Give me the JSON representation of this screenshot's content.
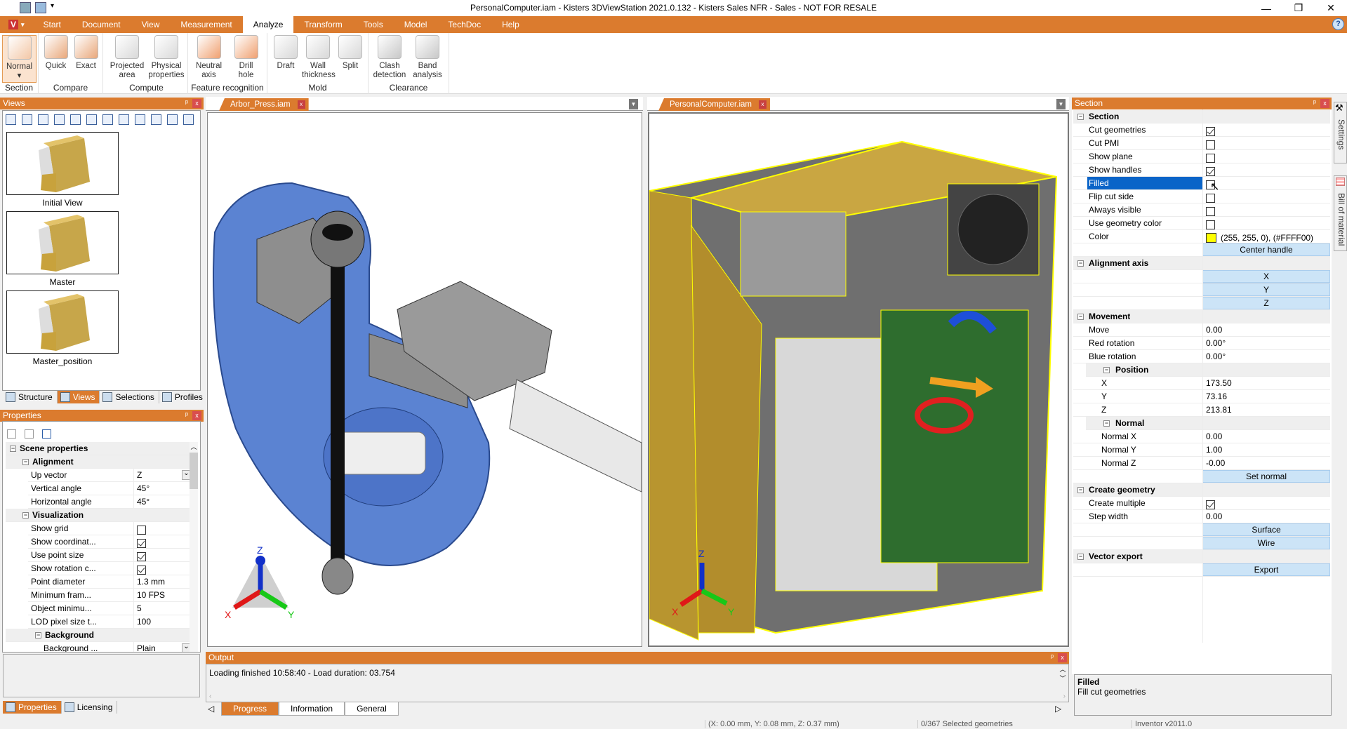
{
  "window": {
    "title": "PersonalComputer.iam - Kisters 3DViewStation 2021.0.132 - Kisters Sales NFR - Sales - NOT FOR RESALE",
    "controls": {
      "minimize": "—",
      "restore": "❐",
      "close": "✕"
    }
  },
  "menu": {
    "logo": "V",
    "tabs": [
      "Start",
      "Document",
      "View",
      "Measurement",
      "Analyze",
      "Transform",
      "Tools",
      "Model",
      "TechDoc",
      "Help"
    ],
    "active": "Analyze",
    "help": "?"
  },
  "ribbon": {
    "groups": [
      {
        "label": "Section",
        "buttons": [
          {
            "label": "Normal",
            "sub": "▾",
            "icon": "section-normal-icon"
          }
        ]
      },
      {
        "label": "Compare",
        "buttons": [
          {
            "label": "Quick",
            "icon": "compare-quick-icon"
          },
          {
            "label": "Exact",
            "icon": "compare-exact-icon"
          }
        ]
      },
      {
        "label": "Compute",
        "buttons": [
          {
            "label": "Projected",
            "sub": "area",
            "icon": "projected-area-icon"
          },
          {
            "label": "Physical",
            "sub": "properties",
            "icon": "physical-properties-icon"
          }
        ]
      },
      {
        "label": "Feature recognition",
        "buttons": [
          {
            "label": "Neutral",
            "sub": "axis",
            "icon": "neutral-axis-icon"
          },
          {
            "label": "Drill",
            "sub": "hole",
            "icon": "drill-hole-icon"
          }
        ]
      },
      {
        "label": "Mold",
        "buttons": [
          {
            "label": "Draft",
            "icon": "draft-icon"
          },
          {
            "label": "Wall",
            "sub": "thickness",
            "icon": "wall-thickness-icon"
          },
          {
            "label": "Split",
            "icon": "split-icon"
          }
        ]
      },
      {
        "label": "Clearance",
        "buttons": [
          {
            "label": "Clash",
            "sub": "detection",
            "icon": "clash-detection-icon"
          },
          {
            "label": "Band",
            "sub": "analysis",
            "icon": "band-analysis-icon"
          }
        ]
      }
    ]
  },
  "views_panel": {
    "title": "Views",
    "pin": "📌",
    "close": "x",
    "views": [
      "Initial View",
      "Master",
      "Master_position"
    ],
    "bottom_tabs": [
      "Structure",
      "Views",
      "Selections",
      "Profiles"
    ],
    "active_tab": "Views"
  },
  "properties_panel": {
    "title": "Properties",
    "rows": [
      {
        "type": "cat",
        "level": 0,
        "name": "Scene properties"
      },
      {
        "type": "cat",
        "level": 1,
        "name": "Alignment"
      },
      {
        "type": "val",
        "level": 2,
        "name": "Up vector",
        "value": "Z",
        "dropdown": true
      },
      {
        "type": "val",
        "level": 2,
        "name": "Vertical angle",
        "value": "45°"
      },
      {
        "type": "val",
        "level": 2,
        "name": "Horizontal angle",
        "value": "45°"
      },
      {
        "type": "cat",
        "level": 1,
        "name": "Visualization"
      },
      {
        "type": "check",
        "level": 2,
        "name": "Show grid",
        "checked": false
      },
      {
        "type": "check",
        "level": 2,
        "name": "Show coordinat...",
        "checked": true
      },
      {
        "type": "check",
        "level": 2,
        "name": "Use point size",
        "checked": true
      },
      {
        "type": "check",
        "level": 2,
        "name": "Show rotation c...",
        "checked": true
      },
      {
        "type": "val",
        "level": 2,
        "name": "Point diameter",
        "value": "1.3 mm"
      },
      {
        "type": "val",
        "level": 2,
        "name": "Minimum fram...",
        "value": "10 FPS"
      },
      {
        "type": "val",
        "level": 2,
        "name": "Object minimu...",
        "value": "5"
      },
      {
        "type": "val",
        "level": 2,
        "name": "LOD pixel size t...",
        "value": "100"
      },
      {
        "type": "cat",
        "level": 2,
        "name": "Background"
      },
      {
        "type": "val",
        "level": 3,
        "name": "Background ...",
        "value": "Plain",
        "dropdown": true
      }
    ],
    "bottom_tabs": [
      "Properties",
      "Licensing"
    ],
    "active_tab": "Properties"
  },
  "documents": [
    {
      "name": "Arbor_Press.iam",
      "close": "x"
    },
    {
      "name": "PersonalComputer.iam",
      "close": "x"
    }
  ],
  "section_panel": {
    "title": "Section",
    "rows": [
      {
        "type": "cat",
        "name": "Section"
      },
      {
        "type": "check",
        "name": "Cut geometries",
        "checked": true
      },
      {
        "type": "check",
        "name": "Cut PMI",
        "checked": false
      },
      {
        "type": "check",
        "name": "Show plane",
        "checked": false
      },
      {
        "type": "check",
        "name": "Show handles",
        "checked": true
      },
      {
        "type": "check",
        "name": "Filled",
        "checked": false,
        "selected": true
      },
      {
        "type": "check",
        "name": "Flip cut side",
        "checked": false
      },
      {
        "type": "check",
        "name": "Always visible",
        "checked": false
      },
      {
        "type": "check",
        "name": "Use geometry color",
        "checked": false
      },
      {
        "type": "color",
        "name": "Color",
        "value": "(255, 255, 0), (#FFFF00)",
        "swatch": "#FFFF00"
      },
      {
        "type": "button",
        "name": "",
        "value": "Center handle"
      },
      {
        "type": "cat",
        "name": "Alignment axis"
      },
      {
        "type": "button",
        "name": "",
        "value": "X"
      },
      {
        "type": "button",
        "name": "",
        "value": "Y"
      },
      {
        "type": "button",
        "name": "",
        "value": "Z"
      },
      {
        "type": "cat",
        "name": "Movement"
      },
      {
        "type": "val",
        "name": "Move",
        "value": "0.00"
      },
      {
        "type": "val",
        "name": "Red rotation",
        "value": "0.00°"
      },
      {
        "type": "val",
        "name": "Blue rotation",
        "value": "0.00°"
      },
      {
        "type": "subcat",
        "name": "Position"
      },
      {
        "type": "subval",
        "name": "X",
        "value": "173.50"
      },
      {
        "type": "subval",
        "name": "Y",
        "value": "73.16"
      },
      {
        "type": "subval",
        "name": "Z",
        "value": "213.81"
      },
      {
        "type": "subcat",
        "name": "Normal"
      },
      {
        "type": "subval",
        "name": "Normal X",
        "value": "0.00"
      },
      {
        "type": "subval",
        "name": "Normal Y",
        "value": "1.00"
      },
      {
        "type": "subval",
        "name": "Normal Z",
        "value": "-0.00"
      },
      {
        "type": "subbutton",
        "name": "",
        "value": "Set normal"
      },
      {
        "type": "cat",
        "name": "Create geometry"
      },
      {
        "type": "check",
        "name": "Create multiple",
        "checked": true
      },
      {
        "type": "val",
        "name": "Step width",
        "value": "0.00"
      },
      {
        "type": "button",
        "name": "",
        "value": "Surface"
      },
      {
        "type": "button",
        "name": "",
        "value": "Wire"
      },
      {
        "type": "cat",
        "name": "Vector export"
      },
      {
        "type": "button",
        "name": "",
        "value": "Export"
      }
    ],
    "description": {
      "title": "Filled",
      "text": "Fill cut geometries"
    }
  },
  "side_tabs": [
    "Settings",
    "Bill of material"
  ],
  "output": {
    "title": "Output",
    "message": "Loading finished 10:58:40 - Load duration: 03.754",
    "tabs": [
      "Progress",
      "Information",
      "General"
    ],
    "active_tab": "Progress"
  },
  "status": {
    "coords": "(X: 0.00 mm, Y: 0.08 mm, Z: 0.37 mm)",
    "selection": "0/367 Selected geometries",
    "source": "Inventor v2011.0"
  },
  "axes": {
    "x": "X",
    "y": "Y",
    "z": "Z"
  },
  "colors": {
    "accent": "#DB7B2E",
    "button_blue": "#CCE4F7",
    "selection": "#0A64C8",
    "cut_color": "#FFFF00"
  }
}
